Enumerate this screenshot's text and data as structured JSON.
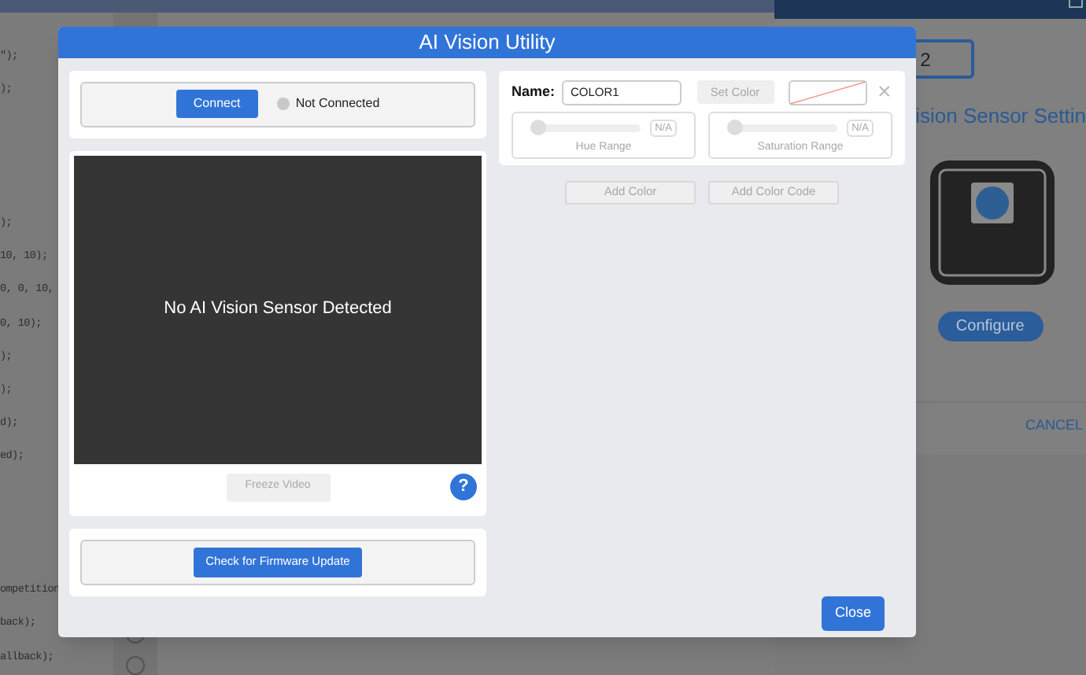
{
  "background": {
    "code_lines": [
      "\");",
      ");",
      ");",
      "10, 10);",
      "0, 0, 10,",
      "0, 10);",
      ");",
      ");",
      "d);",
      "ed);",
      "ompetition",
      "back);",
      "allback);"
    ],
    "side_panel": {
      "port_value": "2",
      "heading": "ision Sensor Settin",
      "configure": "Configure",
      "cancel": "CANCEL"
    }
  },
  "dialog": {
    "title": "AI Vision Utility",
    "connection": {
      "button": "Connect",
      "status": "Not Connected",
      "connected": false
    },
    "video": {
      "message": "No AI Vision Sensor Detected",
      "freeze": "Freeze Video",
      "help": "?"
    },
    "firmware_button": "Check for Firmware Update",
    "color": {
      "name_label": "Name:",
      "name_value": "COLOR1",
      "set_color": "Set Color",
      "remove": "×",
      "ranges": [
        {
          "label": "Hue Range",
          "value": "N/A",
          "level": 0
        },
        {
          "label": "Saturation Range",
          "value": "N/A",
          "level": 0
        }
      ]
    },
    "add_buttons": [
      "Add Color",
      "Add Color Code"
    ],
    "close": "Close"
  }
}
